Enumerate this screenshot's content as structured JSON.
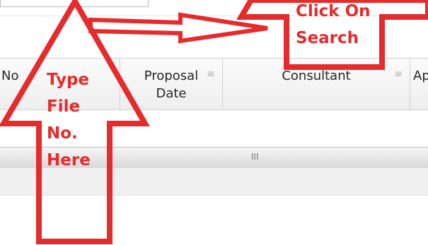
{
  "grid": {
    "columns": [
      {
        "label": "No"
      },
      {
        "label": "Proposal\nDate"
      },
      {
        "label": "Consultant"
      },
      {
        "label": "Ap"
      }
    ],
    "scroll_marker": "III"
  },
  "annotations": {
    "type_file": [
      "Type",
      "File",
      "No.",
      "Here"
    ],
    "click_search": [
      "Click On",
      "Search"
    ],
    "color": "#e52b2b"
  }
}
